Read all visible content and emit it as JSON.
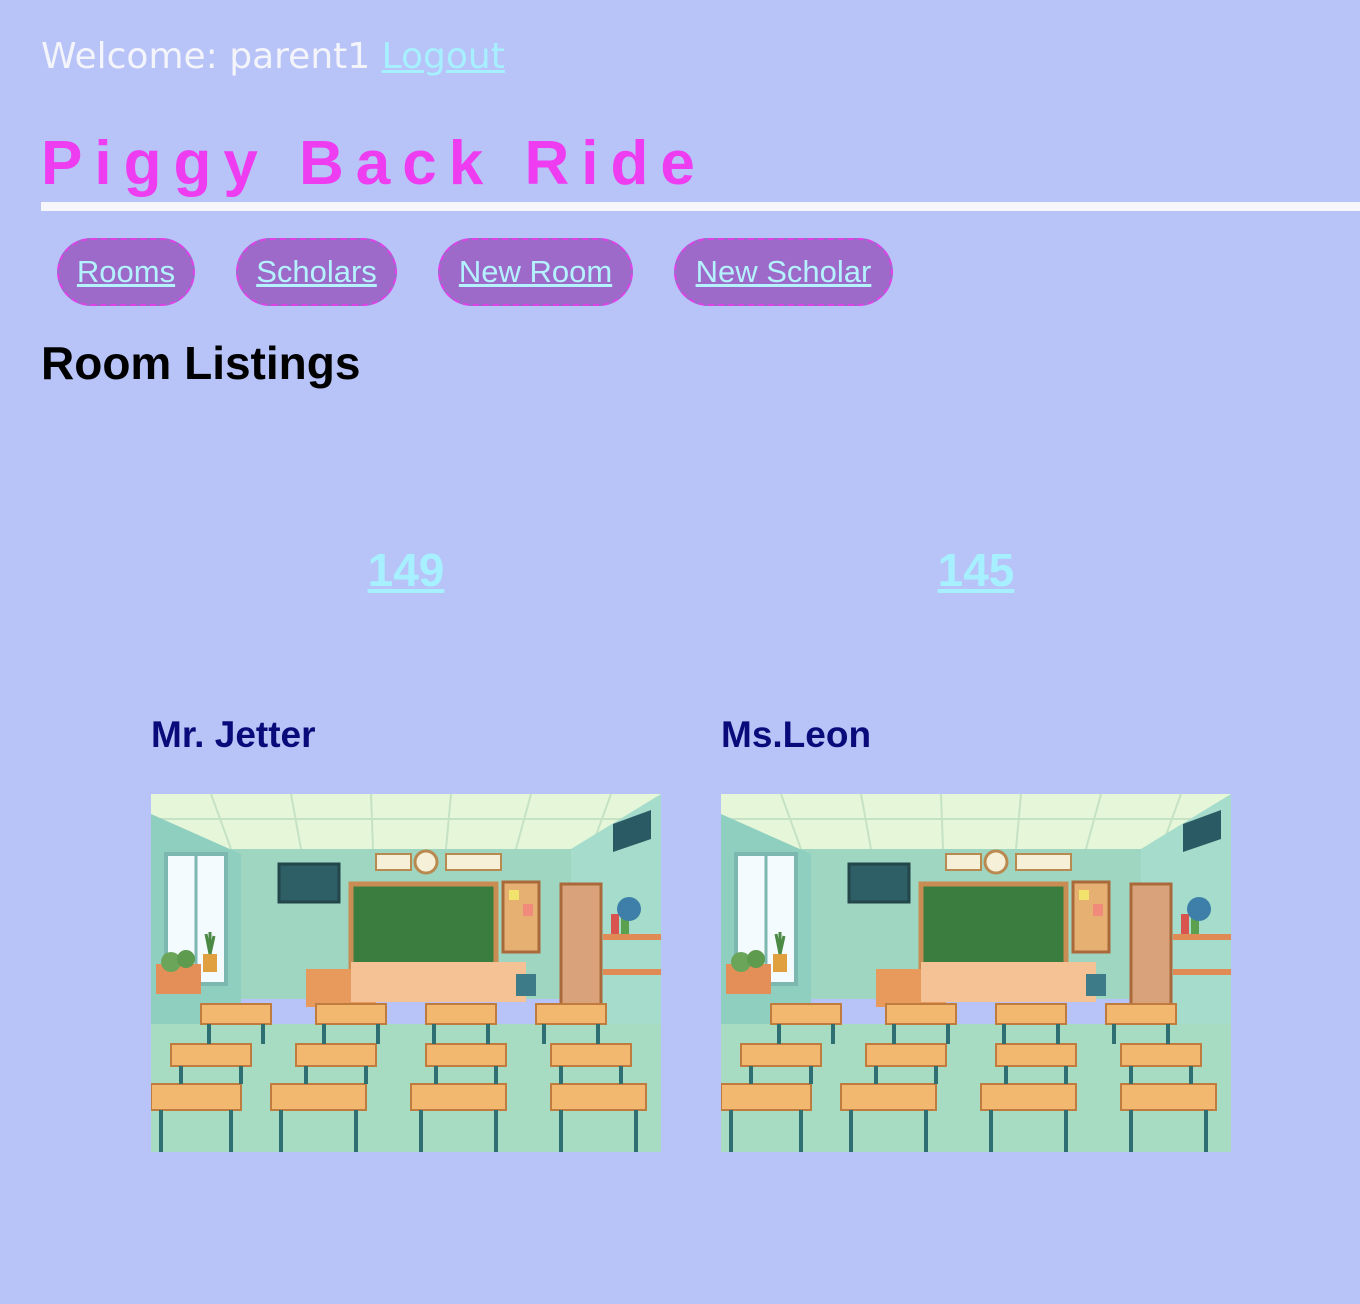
{
  "header": {
    "welcome_text": "Welcome: parent1",
    "logout_label": "Logout"
  },
  "site": {
    "title": "Piggy Back Ride"
  },
  "nav": {
    "items": [
      {
        "label": "Rooms"
      },
      {
        "label": "Scholars"
      },
      {
        "label": "New Room"
      },
      {
        "label": "New Scholar"
      }
    ]
  },
  "main": {
    "heading": "Room Listings",
    "rooms": [
      {
        "number": "149",
        "teacher": "Mr. Jetter",
        "image": "classroom-illustration"
      },
      {
        "number": "145",
        "teacher": "Ms.Leon",
        "image": "classroom-illustration"
      }
    ]
  },
  "colors": {
    "background": "#b8c3f8",
    "title": "#ee3df0",
    "link": "#a6f0ff",
    "nav_pill": "#9d6ac9",
    "teacher_name": "#0a0a7a"
  }
}
